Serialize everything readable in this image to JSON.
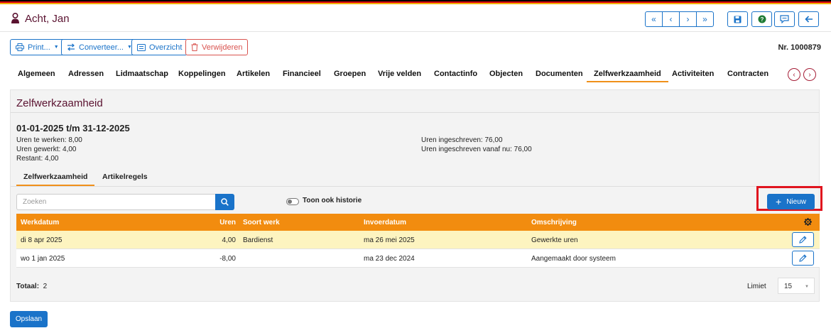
{
  "header": {
    "title": "Acht, Jan",
    "colors": {
      "accent": "#1a73c9",
      "brand": "#5a1230",
      "orange": "#f28c0f",
      "highlight": "#e0141e"
    }
  },
  "actions": {
    "print": "Print...",
    "convert": "Converteer...",
    "overview": "Overzicht",
    "delete": "Verwijderen",
    "number": "Nr. 1000879"
  },
  "tabs": [
    "Algemeen",
    "Adressen",
    "Lidmaatschap",
    "Koppelingen",
    "Artikelen",
    "Financieel",
    "Groepen",
    "Vrije velden",
    "Contactinfo",
    "Objecten",
    "Documenten",
    "Zelfwerkzaamheid",
    "Activiteiten",
    "Contracten"
  ],
  "active_tab": "Zelfwerkzaamheid",
  "section": {
    "title": "Zelfwerkzaamheid",
    "period": "01-01-2025 t/m 31-12-2025",
    "left_info": [
      "Uren te werken: 8,00",
      "Uren gewerkt: 4,00",
      "Restant: 4,00"
    ],
    "right_info": [
      "Uren ingeschreven: 76,00",
      "Uren ingeschreven vanaf nu: 76,00"
    ],
    "subtabs": [
      "Zelfwerkzaamheid",
      "Artikelregels"
    ],
    "search_placeholder": "Zoeken",
    "toggle_label": "Toon ook historie",
    "new_button": "Nieuw"
  },
  "table": {
    "headers": {
      "workdate": "Werkdatum",
      "hours": "Uren",
      "kind": "Soort werk",
      "entrydate": "Invoerdatum",
      "description": "Omschrijving"
    },
    "rows": [
      {
        "workdate": "di 8 apr 2025",
        "hours": "4,00",
        "kind": "Bardienst",
        "entrydate": "ma 26 mei 2025",
        "description": "Gewerkte uren"
      },
      {
        "workdate": "wo 1 jan 2025",
        "hours": "-8,00",
        "kind": "",
        "entrydate": "ma 23 dec 2024",
        "description": "Aangemaakt door systeem"
      }
    ],
    "total_label": "Totaal:",
    "total_value": "2",
    "limit_label": "Limiet",
    "limit_value": "15"
  },
  "footer": {
    "save": "Opslaan"
  }
}
